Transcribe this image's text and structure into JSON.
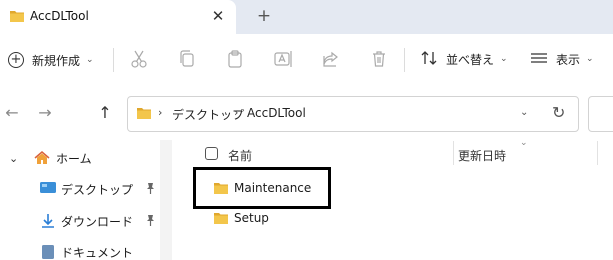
{
  "window": {
    "tab_title": "AccDLTool",
    "tab_close_glyph": "✕",
    "new_tab_glyph": "+"
  },
  "toolbar": {
    "new_label": "新規作成",
    "sort_label": "並べ替え",
    "view_label": "表示",
    "chevron": "⌄"
  },
  "address": {
    "back": "←",
    "forward": "→",
    "up": "↑",
    "crumbs": [
      "デスクトップ",
      "AccDLTool"
    ],
    "separator": "›",
    "dropdown": "⌄",
    "refresh": "↻"
  },
  "sidebar": {
    "items": [
      {
        "label": "ホーム",
        "expand": "⌄"
      },
      {
        "label": "デスクトップ"
      },
      {
        "label": "ダウンロード"
      },
      {
        "label": "ドキュメント"
      }
    ]
  },
  "files": {
    "columns": {
      "name": "名前",
      "date": "更新日時",
      "sort_glyph": "⌄"
    },
    "rows": [
      {
        "name": "Maintenance"
      },
      {
        "name": "Setup"
      }
    ]
  },
  "colors": {
    "folder": "#f3c64b",
    "folder_dark": "#e0a82e",
    "titlebar_bg": "#e4e9f2",
    "home_icon": "#d9623b",
    "download_icon": "#2b7fd6",
    "desktop_icon": "#3a8fd8",
    "highlight_border": "#000000"
  }
}
